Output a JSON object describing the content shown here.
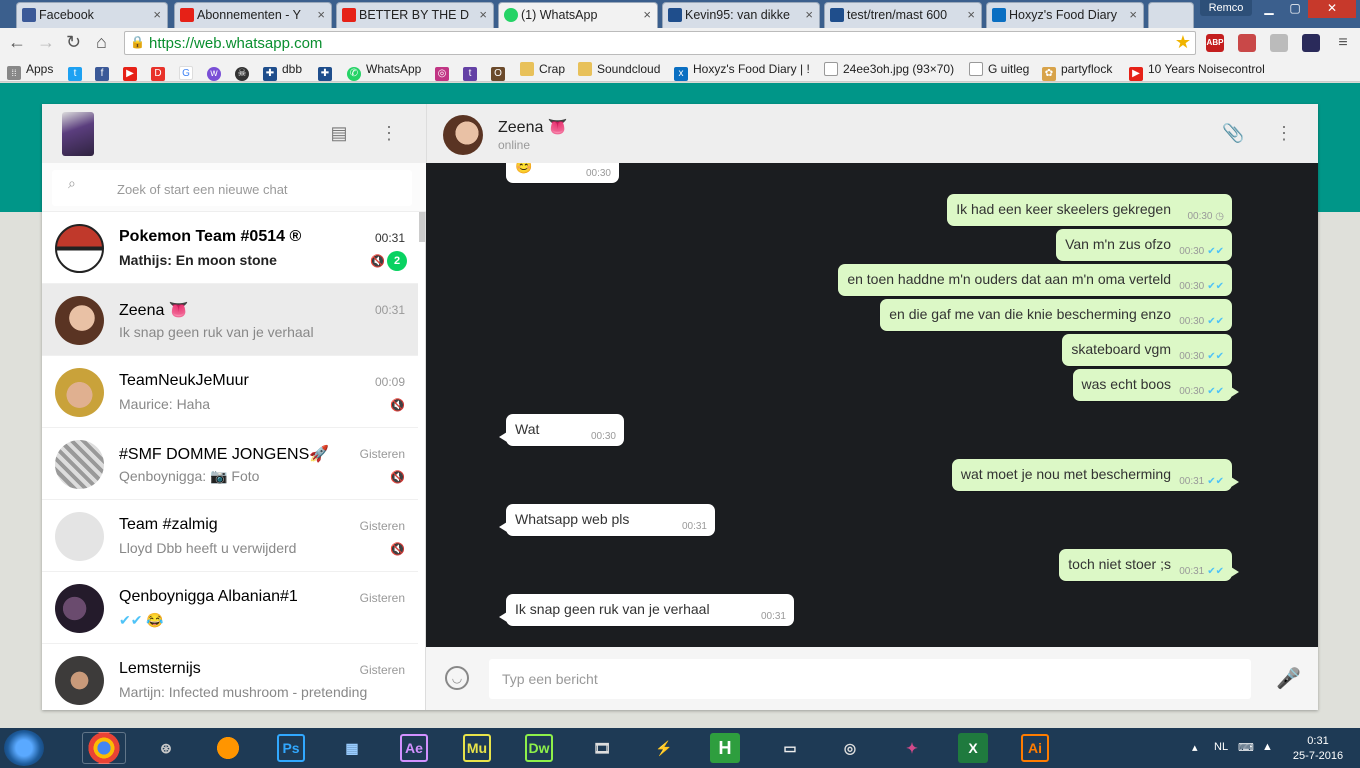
{
  "browser": {
    "tabs": [
      {
        "title": "Facebook",
        "icon": "facebook-icon",
        "color": "#3b5998"
      },
      {
        "title": "Abonnementen - Y",
        "icon": "youtube-icon",
        "color": "#e62117"
      },
      {
        "title": "BETTER BY THE D",
        "icon": "youtube-icon",
        "color": "#e62117"
      },
      {
        "title": "(1) WhatsApp",
        "icon": "whatsapp-icon",
        "color": "#25d366"
      },
      {
        "title": "Kevin95: van dikke",
        "icon": "dbb-icon",
        "color": "#1f4e8c"
      },
      {
        "title": "test/tren/mast 600",
        "icon": "dbb-icon",
        "color": "#1f4e8c"
      },
      {
        "title": "Hoxyz's Food Diary",
        "icon": "myfitness-icon",
        "color": "#0a6fc2"
      }
    ],
    "user_label": "Remco",
    "url": "https://web.whatsapp.com",
    "bookmarks": [
      {
        "label": "Apps",
        "icon": "apps-grid-icon"
      },
      {
        "label": "",
        "icon": "twitter-icon"
      },
      {
        "label": "",
        "icon": "facebook-icon"
      },
      {
        "label": "",
        "icon": "youtube-icon"
      },
      {
        "label": "",
        "icon": "dumpert-icon"
      },
      {
        "label": "",
        "icon": "google-icon"
      },
      {
        "label": "",
        "icon": "twitch-like-icon"
      },
      {
        "label": "",
        "icon": "skull-icon"
      },
      {
        "label": "dbb",
        "icon": "dbb-icon"
      },
      {
        "label": "",
        "icon": "dbb-icon"
      },
      {
        "label": "WhatsApp",
        "icon": "whatsapp-icon"
      },
      {
        "label": "",
        "icon": "instagram-icon"
      },
      {
        "label": "",
        "icon": "twitch-icon"
      },
      {
        "label": "",
        "icon": "ogame-icon"
      },
      {
        "label": "Crap",
        "icon": "folder-icon"
      },
      {
        "label": "Soundcloud",
        "icon": "folder-icon"
      },
      {
        "label": "Hoxyz's Food Diary | !",
        "icon": "myfitness-icon"
      },
      {
        "label": "24ee3oh.jpg (93×70)",
        "icon": "image-icon"
      },
      {
        "label": "G uitleg",
        "icon": "document-icon"
      },
      {
        "label": "partyflock",
        "icon": "partyflock-icon"
      },
      {
        "label": "10 Years Noisecontrol",
        "icon": "youtube-icon"
      }
    ]
  },
  "search": {
    "placeholder": "Zoek of start een nieuwe chat"
  },
  "chats": [
    {
      "name": "Pokemon Team #0514 ®",
      "time": "00:31",
      "preview": "Mathijs: En moon stone",
      "unread": "2",
      "bold": true,
      "muted": true
    },
    {
      "name": "Zeena 👅",
      "time": "00:31",
      "preview": "Ik snap geen ruk van je verhaal",
      "selected": true
    },
    {
      "name": "TeamNeukJeMuur",
      "time": "00:09",
      "preview": "Maurice: Haha",
      "muted": true
    },
    {
      "name": "#SMF DOMME JONGENS🚀",
      "time": "Gisteren",
      "preview": "Qenboynigga: 📷 Foto",
      "muted": true
    },
    {
      "name": "Team #zalmig",
      "time": "Gisteren",
      "preview": "Lloyd Dbb heeft u verwijderd",
      "muted": true
    },
    {
      "name": "Qenboynigga Albanian#1",
      "time": "Gisteren",
      "preview": "✔✔ 😂"
    },
    {
      "name": "Lemsternijs",
      "time": "Gisteren",
      "preview": "Martijn: Infected mushroom - pretending"
    }
  ],
  "conversation": {
    "name": "Zeena 👅",
    "status": "online",
    "messages": [
      {
        "dir": "in",
        "text": "😊",
        "time": "00:30"
      },
      {
        "dir": "out",
        "text": "Ik had een keer skeelers gekregen",
        "time": "00:30",
        "status": "pending"
      },
      {
        "dir": "out",
        "text": "Van m'n zus ofzo",
        "time": "00:30",
        "status": "read"
      },
      {
        "dir": "out",
        "text": "en toen haddne m'n ouders dat aan m'n oma verteld",
        "time": "00:30",
        "status": "read"
      },
      {
        "dir": "out",
        "text": "en die gaf me van die knie bescherming enzo",
        "time": "00:30",
        "status": "read"
      },
      {
        "dir": "out",
        "text": "skateboard vgm",
        "time": "00:30",
        "status": "read"
      },
      {
        "dir": "out",
        "text": "was echt boos",
        "time": "00:30",
        "status": "read"
      },
      {
        "dir": "in",
        "text": "Wat",
        "time": "00:30"
      },
      {
        "dir": "out",
        "text": "wat moet je nou met bescherming",
        "time": "00:31",
        "status": "read"
      },
      {
        "dir": "in",
        "text": "Whatsapp web pls",
        "time": "00:31"
      },
      {
        "dir": "out",
        "text": "toch niet stoer ;s",
        "time": "00:31",
        "status": "read"
      },
      {
        "dir": "in",
        "text": "Ik snap geen ruk van je verhaal",
        "time": "00:31"
      }
    ],
    "compose_placeholder": "Typ een bericht"
  },
  "taskbar": {
    "apps": [
      "chrome",
      "steam",
      "firefox",
      "Ps",
      "remote-desktop",
      "Ae",
      "Mu",
      "Dw",
      "video-editor",
      "fl-studio",
      "H",
      "99",
      "rockstar",
      "game",
      "excel",
      "Ai"
    ],
    "language": "NL",
    "time": "0:31",
    "date": "25-7-2016"
  }
}
